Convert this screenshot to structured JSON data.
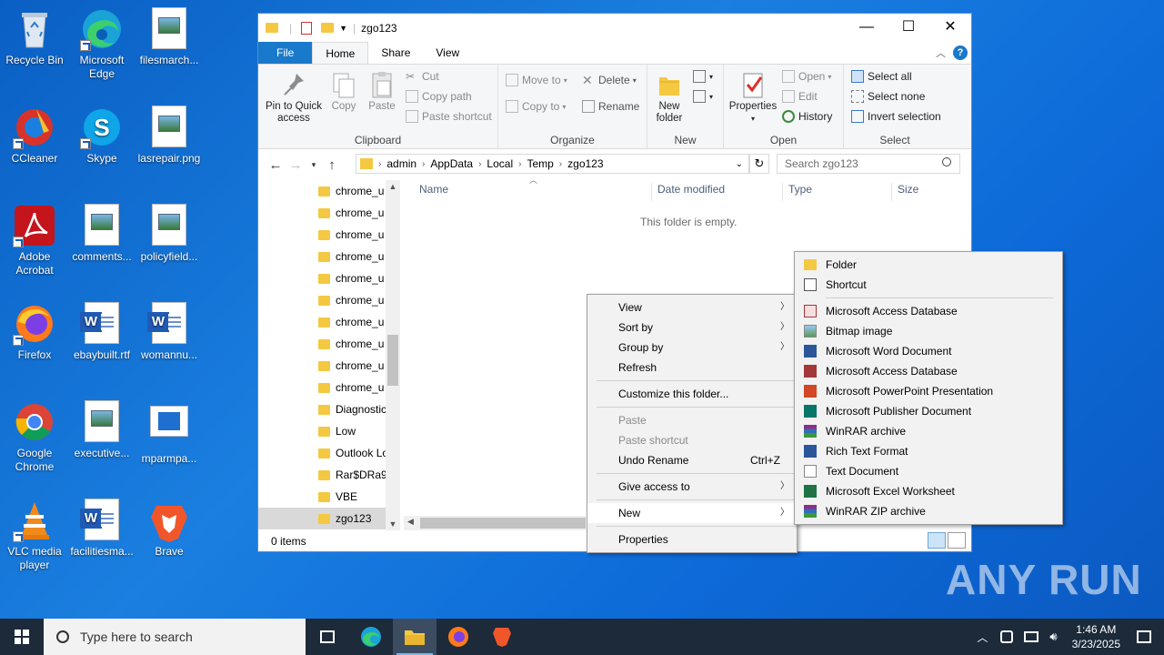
{
  "desktop": {
    "icons": [
      {
        "label": "Recycle Bin",
        "icon": "recycle-bin-icon"
      },
      {
        "label": "Microsoft Edge",
        "icon": "edge-icon"
      },
      {
        "label": "filesmarch...",
        "icon": "image-file-icon"
      },
      {
        "label": "CCleaner",
        "icon": "ccleaner-icon"
      },
      {
        "label": "Skype",
        "icon": "skype-icon"
      },
      {
        "label": "lasrepair.png",
        "icon": "image-file-icon"
      },
      {
        "label": "Adobe Acrobat",
        "icon": "acrobat-icon"
      },
      {
        "label": "comments...",
        "icon": "image-file-icon"
      },
      {
        "label": "policyfield...",
        "icon": "image-file-icon"
      },
      {
        "label": "Firefox",
        "icon": "firefox-icon"
      },
      {
        "label": "ebaybuilt.rtf",
        "icon": "word-doc-icon"
      },
      {
        "label": "womannu...",
        "icon": "word-doc-icon"
      },
      {
        "label": "Google Chrome",
        "icon": "chrome-icon"
      },
      {
        "label": "executive...",
        "icon": "image-file-icon"
      },
      {
        "label": "mparmpa...",
        "icon": "image-file-icon"
      },
      {
        "label": "VLC media player",
        "icon": "vlc-icon"
      },
      {
        "label": "facilitiesma...",
        "icon": "word-doc-icon"
      },
      {
        "label": "Brave",
        "icon": "brave-icon"
      }
    ]
  },
  "explorer": {
    "title": "zgo123",
    "tabs": [
      "File",
      "Home",
      "Share",
      "View"
    ],
    "ribbon": {
      "clipboard": {
        "label": "Clipboard",
        "pin": "Pin to Quick access",
        "copy": "Copy",
        "paste": "Paste",
        "cut": "Cut",
        "copy_path": "Copy path",
        "paste_shortcut": "Paste shortcut"
      },
      "organize": {
        "label": "Organize",
        "move_to": "Move to",
        "copy_to": "Copy to",
        "delete": "Delete",
        "rename": "Rename"
      },
      "new": {
        "label": "New",
        "new_folder": "New folder"
      },
      "open": {
        "label": "Open",
        "properties": "Properties",
        "open": "Open",
        "edit": "Edit",
        "history": "History"
      },
      "select": {
        "label": "Select",
        "select_all": "Select all",
        "select_none": "Select none",
        "invert": "Invert selection"
      }
    },
    "breadcrumb": [
      "admin",
      "AppData",
      "Local",
      "Temp",
      "zgo123"
    ],
    "search_placeholder": "Search zgo123",
    "tree": [
      "chrome_u",
      "chrome_u",
      "chrome_u",
      "chrome_u",
      "chrome_u",
      "chrome_u",
      "chrome_u",
      "chrome_u",
      "chrome_u",
      "chrome_u",
      "Diagnostic",
      "Low",
      "Outlook Lo",
      "Rar$DRa98",
      "VBE",
      "zgo123"
    ],
    "columns": [
      "Name",
      "Date modified",
      "Type",
      "Size"
    ],
    "empty_text": "This folder is empty.",
    "status": "0 items"
  },
  "context_menu": {
    "items": [
      {
        "label": "View",
        "submenu": true
      },
      {
        "label": "Sort by",
        "submenu": true
      },
      {
        "label": "Group by",
        "submenu": true
      },
      {
        "label": "Refresh"
      },
      {
        "label": "Customize this folder..."
      },
      {
        "label": "Paste",
        "disabled": true
      },
      {
        "label": "Paste shortcut",
        "disabled": true
      },
      {
        "label": "Undo Rename",
        "accel": "Ctrl+Z"
      },
      {
        "label": "Give access to",
        "submenu": true
      },
      {
        "label": "New",
        "submenu": true
      },
      {
        "label": "Properties"
      }
    ]
  },
  "new_menu": {
    "items": [
      {
        "label": "Folder",
        "icon": "folder-icon"
      },
      {
        "label": "Shortcut",
        "icon": "shortcut-icon"
      },
      {
        "label": "Microsoft Access Database",
        "icon": "access-icon"
      },
      {
        "label": "Bitmap image",
        "icon": "bitmap-icon"
      },
      {
        "label": "Microsoft Word Document",
        "icon": "word-icon"
      },
      {
        "label": "Microsoft Access Database",
        "icon": "access-icon"
      },
      {
        "label": "Microsoft PowerPoint Presentation",
        "icon": "powerpoint-icon"
      },
      {
        "label": "Microsoft Publisher Document",
        "icon": "publisher-icon"
      },
      {
        "label": "WinRAR archive",
        "icon": "winrar-icon"
      },
      {
        "label": "Rich Text Format",
        "icon": "rtf-icon"
      },
      {
        "label": "Text Document",
        "icon": "text-doc-icon"
      },
      {
        "label": "Microsoft Excel Worksheet",
        "icon": "excel-icon"
      },
      {
        "label": "WinRAR ZIP archive",
        "icon": "winrar-zip-icon"
      }
    ]
  },
  "taskbar": {
    "search_placeholder": "Type here to search",
    "time": "1:46 AM",
    "date": "3/23/2025"
  },
  "watermark": "ANY RUN",
  "colors": {
    "accent": "#1979ca",
    "desktop": "#0a64d0",
    "taskbar": "#1c2a3a"
  }
}
